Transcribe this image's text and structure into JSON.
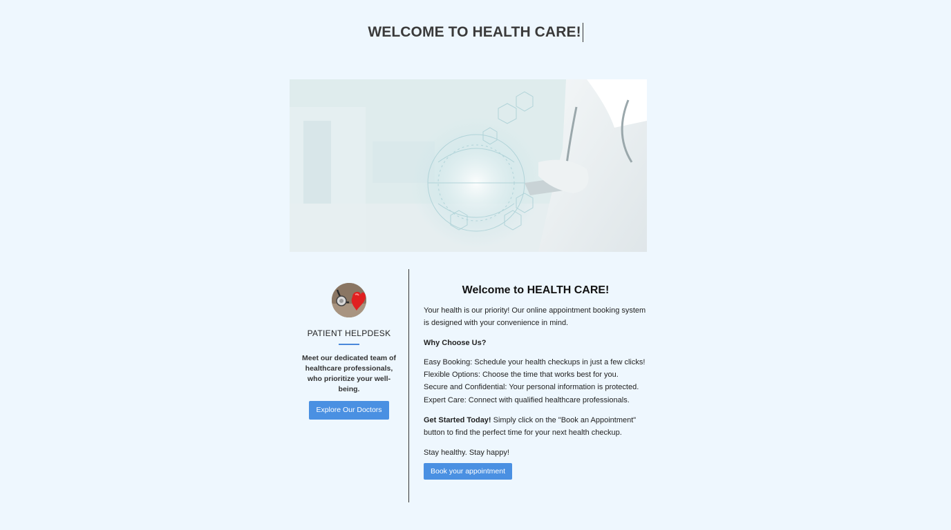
{
  "header": {
    "title": "WELCOME TO HEALTH CARE!"
  },
  "hero": {
    "icon": "doctor-tablet-medical-network-image"
  },
  "sidebar": {
    "avatar_icon": "stethoscope-heart-icon",
    "heading": "PATIENT HELPDESK",
    "description": "Meet our dedicated team of healthcare professionals, who prioritize your well-being.",
    "button_label": "Explore Our Doctors",
    "accent_color": "#4a88da"
  },
  "content": {
    "heading": "Welcome to HEALTH CARE!",
    "intro": "Your health is our priority! Our online appointment booking system is designed with your convenience in mind.",
    "why_heading": "Why Choose Us?",
    "features": [
      "Easy Booking: Schedule your health checkups in just a few clicks!",
      "Flexible Options: Choose the time that works best for you.",
      "Secure and Confidential: Your personal information is protected.",
      "Expert Care: Connect with qualified healthcare professionals."
    ],
    "started_bold": "Get Started Today!",
    "started_text": " Simply click on the \"Book an Appointment\" button to find the perfect time for your next health checkup.",
    "closing": "Stay healthy. Stay happy!",
    "button_label": "Book your appointment"
  },
  "colors": {
    "background": "#eef7fe",
    "button": "#4a90e2",
    "divider": "#333333"
  }
}
